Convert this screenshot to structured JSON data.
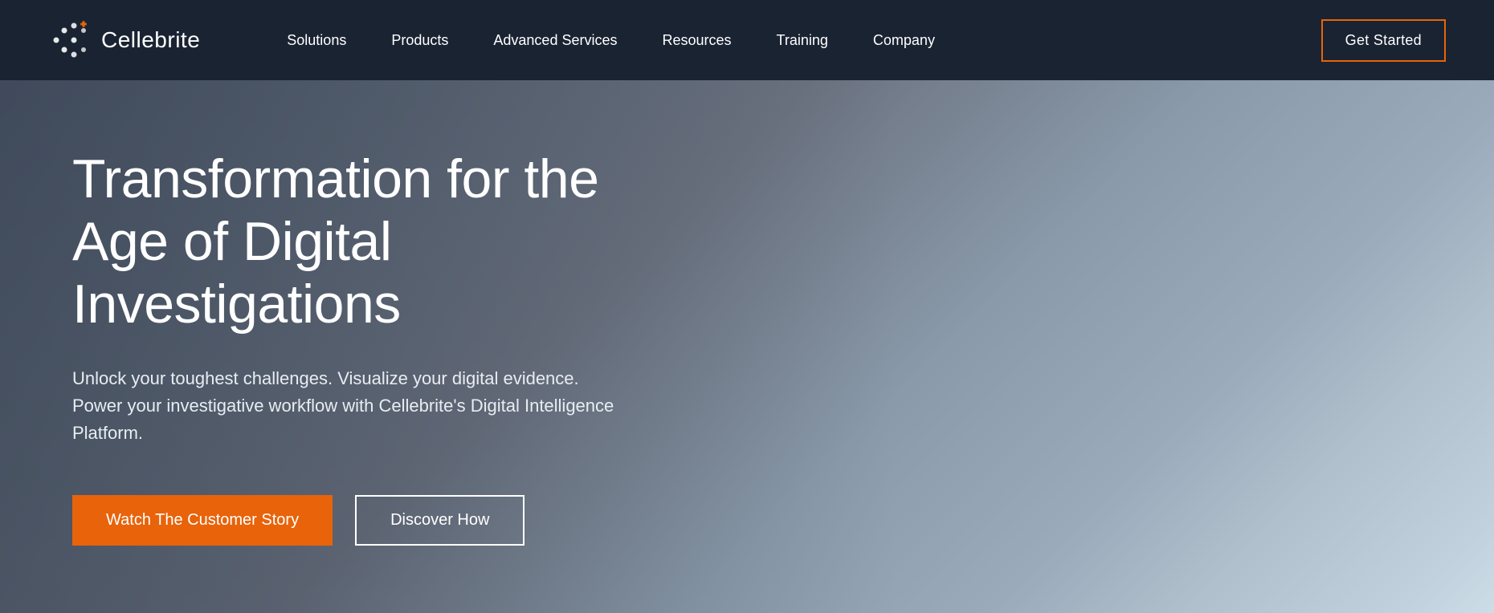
{
  "navbar": {
    "brand_name": "Cellebrite",
    "nav_links": [
      {
        "label": "Solutions",
        "id": "solutions"
      },
      {
        "label": "Products",
        "id": "products"
      },
      {
        "label": "Advanced Services",
        "id": "advanced-services"
      },
      {
        "label": "Resources",
        "id": "resources"
      },
      {
        "label": "Training",
        "id": "training"
      },
      {
        "label": "Company",
        "id": "company"
      }
    ],
    "cta_label": "Get Started"
  },
  "hero": {
    "title": "Transformation for the Age of Digital Investigations",
    "subtitle": "Unlock your toughest challenges. Visualize your digital evidence. Power your investigative workflow with Cellebrite's Digital Intelligence Platform.",
    "btn_primary_label": "Watch The Customer Story",
    "btn_secondary_label": "Discover How"
  },
  "colors": {
    "nav_bg": "#1a2332",
    "accent": "#e8630a",
    "white": "#ffffff"
  }
}
